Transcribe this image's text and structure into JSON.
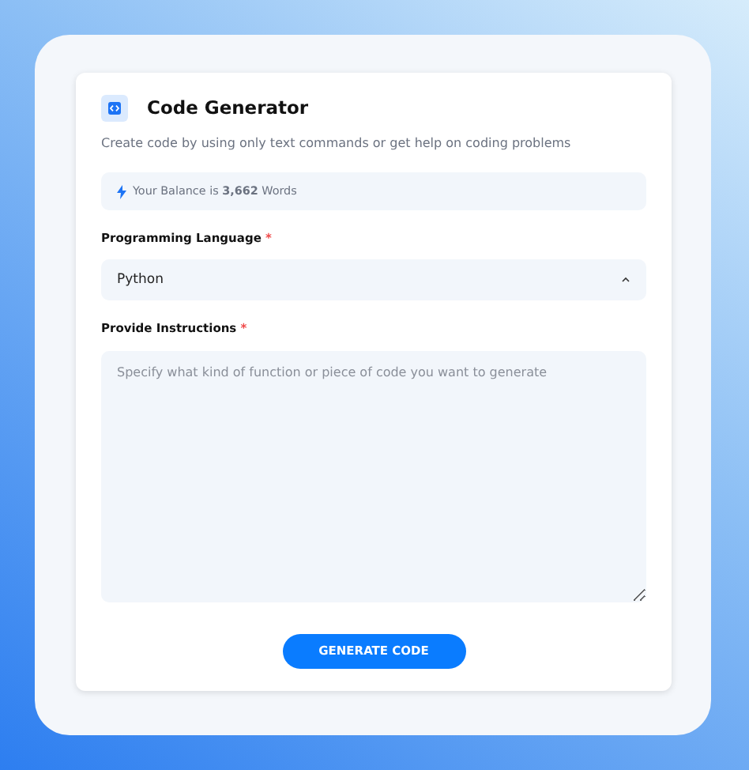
{
  "title": "Code Generator",
  "subtitle": "Create code by using only text commands or get help on coding problems",
  "balance": "Your Balance is **3,662** Words",
  "fields": [
    {
      "kind": "select",
      "label": "Programming Language",
      "required_mark": "*",
      "value": "Python",
      "expanded": true
    },
    {
      "kind": "textarea",
      "label": "Provide Instructions",
      "required_mark": "*",
      "placeholder": "Specify what kind of function or piece of code you want to generate"
    }
  ],
  "button": "GENERATE CODE"
}
